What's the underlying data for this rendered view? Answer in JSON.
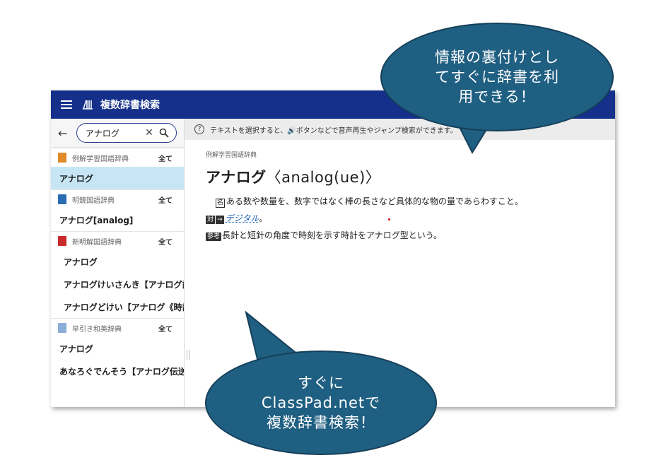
{
  "app": {
    "title": "複数辞書検索"
  },
  "search": {
    "value": "アナログ"
  },
  "hint": "テキストを選択すると、🔊ボタンなどで音声再生やジャンプ検索ができます。",
  "sidebar": {
    "all_label": "全て",
    "groups": [
      {
        "dict": "例解学習国語辞典",
        "icon_color": "#e08a2a",
        "entries": [
          "アナログ"
        ]
      },
      {
        "dict": "明鏡国語辞典",
        "icon_color": "#2a6db5",
        "entries": [
          "アナログ[analog]"
        ]
      },
      {
        "dict": "新明解国語辞典",
        "icon_color": "#c92a2a",
        "entries": [
          "アナログ",
          "アナログけいさんき【アナログ計",
          "アナログどけい【アナログ《時計"
        ]
      },
      {
        "dict": "早引き和英辞典",
        "icon_color": "#8aaed6",
        "entries": [
          "アナログ",
          "あなろぐでんそう【アナログ伝送"
        ]
      }
    ]
  },
  "entry": {
    "breadcrumb": "例解学習国語辞典",
    "headword": "アナログ",
    "origin": "〈analog(ue)〉",
    "pos_tag": "名",
    "definition": "ある数や数量を、数字ではなく棒の長さなど具体的な物の量であらわすこと。",
    "antonym_tag": "対",
    "antonym_arrow": "→",
    "antonym_link": "デジタル",
    "antonym_end": "。",
    "ref_tag": "参考",
    "reference": "長針と短針の角度で時刻を示す時計をアナログ型という。"
  },
  "callouts": {
    "top": [
      "情報の裏付けとし",
      "てすぐに辞書を利",
      "用できる！"
    ],
    "bottom": [
      "すぐに",
      "ClassPad.netで",
      "複数辞書検索！"
    ]
  },
  "colors": {
    "topbar": "#14308a",
    "selected": "#c6e6f5",
    "bubble": "#1f5f82"
  }
}
